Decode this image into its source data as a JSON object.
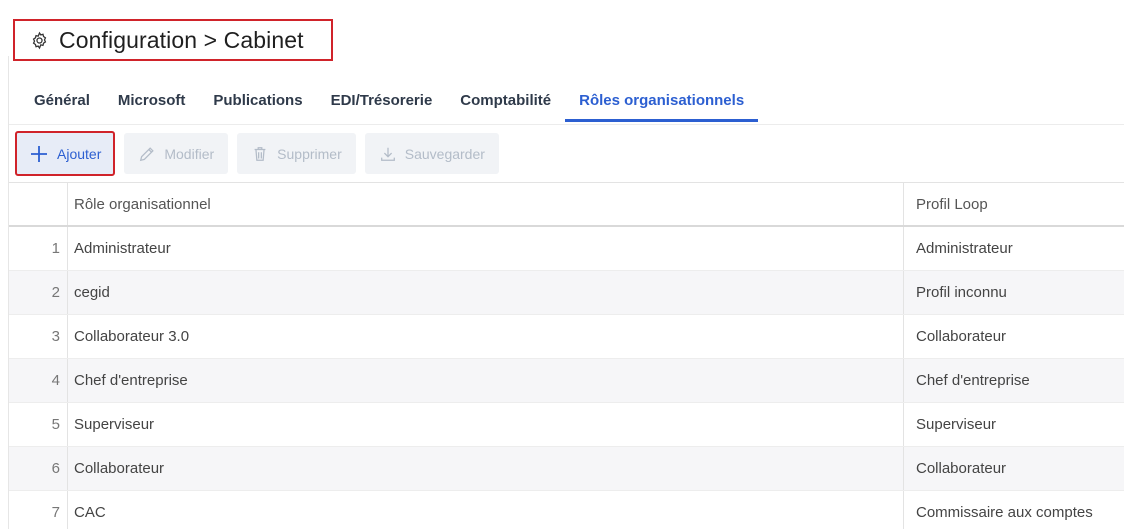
{
  "header": {
    "title": "Configuration > Cabinet",
    "icon": "gear-icon"
  },
  "tabs": [
    {
      "label": "Général",
      "active": false
    },
    {
      "label": "Microsoft",
      "active": false
    },
    {
      "label": "Publications",
      "active": false
    },
    {
      "label": "EDI/Trésorerie",
      "active": false
    },
    {
      "label": "Comptabilité",
      "active": false
    },
    {
      "label": "Rôles organisationnels",
      "active": true
    }
  ],
  "toolbar": {
    "add_label": "Ajouter",
    "edit_label": "Modifier",
    "delete_label": "Supprimer",
    "save_label": "Sauvegarder"
  },
  "table": {
    "columns": [
      "Rôle organisationnel",
      "Profil Loop"
    ],
    "rows": [
      {
        "num": "1",
        "role": "Administrateur",
        "profile": "Administrateur"
      },
      {
        "num": "2",
        "role": "cegid",
        "profile": "Profil inconnu"
      },
      {
        "num": "3",
        "role": "Collaborateur 3.0",
        "profile": "Collaborateur"
      },
      {
        "num": "4",
        "role": "Chef d'entreprise",
        "profile": "Chef d'entreprise"
      },
      {
        "num": "5",
        "role": "Superviseur",
        "profile": "Superviseur"
      },
      {
        "num": "6",
        "role": "Collaborateur",
        "profile": "Collaborateur"
      },
      {
        "num": "7",
        "role": "CAC",
        "profile": "Commissaire aux comptes"
      }
    ]
  },
  "colors": {
    "accent": "#2c5fd1",
    "highlight_border": "#d0232a",
    "disabled_text": "#b3bcc8"
  }
}
